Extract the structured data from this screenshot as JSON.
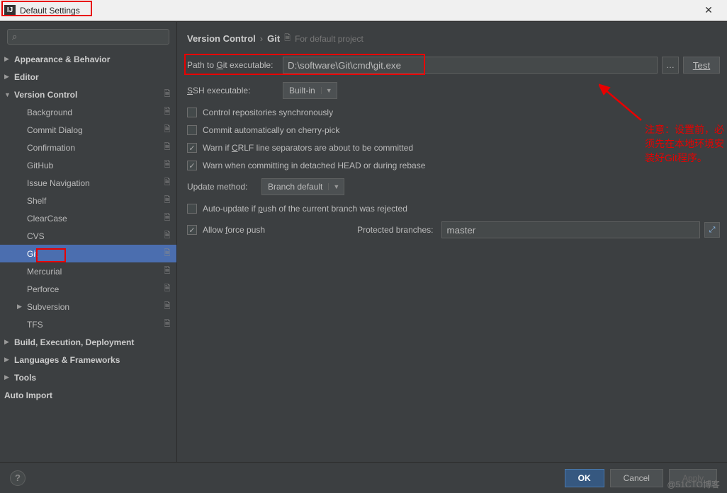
{
  "window": {
    "title": "Default Settings"
  },
  "sidebar": {
    "search_placeholder": "",
    "items": [
      {
        "label": "Appearance & Behavior",
        "level": 1,
        "bold": true,
        "arrow": "▶"
      },
      {
        "label": "Editor",
        "level": 1,
        "bold": true,
        "arrow": "▶"
      },
      {
        "label": "Version Control",
        "level": 1,
        "bold": true,
        "arrow": "▼",
        "scope": true
      },
      {
        "label": "Background",
        "level": 2,
        "scope": true
      },
      {
        "label": "Commit Dialog",
        "level": 2,
        "scope": true
      },
      {
        "label": "Confirmation",
        "level": 2,
        "scope": true
      },
      {
        "label": "GitHub",
        "level": 2,
        "scope": true
      },
      {
        "label": "Issue Navigation",
        "level": 2,
        "scope": true
      },
      {
        "label": "Shelf",
        "level": 2,
        "scope": true
      },
      {
        "label": "ClearCase",
        "level": 2,
        "scope": true
      },
      {
        "label": "CVS",
        "level": 2,
        "scope": true
      },
      {
        "label": "Git",
        "level": 2,
        "scope": true,
        "selected": true
      },
      {
        "label": "Mercurial",
        "level": 2,
        "scope": true
      },
      {
        "label": "Perforce",
        "level": 2,
        "scope": true
      },
      {
        "label": "Subversion",
        "level": 2,
        "has_arrow": true,
        "arrow": "▶",
        "scope": true
      },
      {
        "label": "TFS",
        "level": 2,
        "scope": true
      },
      {
        "label": "Build, Execution, Deployment",
        "level": 1,
        "bold": true,
        "arrow": "▶"
      },
      {
        "label": "Languages & Frameworks",
        "level": 1,
        "bold": true,
        "arrow": "▶"
      },
      {
        "label": "Tools",
        "level": 1,
        "bold": true,
        "arrow": "▶"
      },
      {
        "label": "Auto Import",
        "level": 1,
        "bold": true
      }
    ]
  },
  "breadcrumb": {
    "part1": "Version Control",
    "part2": "Git",
    "project_scope": "For default project"
  },
  "git": {
    "exe_label": "Path to Git executable:",
    "exe_path": "D:\\software\\Git\\cmd\\git.exe",
    "test_label": "Test",
    "ssh_label": "SSH executable:",
    "ssh_value": "Built-in",
    "cb_sync": "Control repositories synchronously",
    "cb_cherry": "Commit automatically on cherry-pick",
    "cb_crlf": "Warn if CRLF line separators are about to be committed",
    "cb_detached": "Warn when committing in detached HEAD or during rebase",
    "update_label": "Update method:",
    "update_value": "Branch default",
    "cb_autoupdate": "Auto-update if push of the current branch was rejected",
    "cb_force": "Allow force push",
    "protected_label": "Protected branches:",
    "protected_value": "master"
  },
  "annotation": {
    "text": "注意：设置前，必须先在本地环境安装好Git程序。"
  },
  "footer": {
    "ok": "OK",
    "cancel": "Cancel",
    "apply": "Apply"
  },
  "watermark": "@51CTO博客"
}
